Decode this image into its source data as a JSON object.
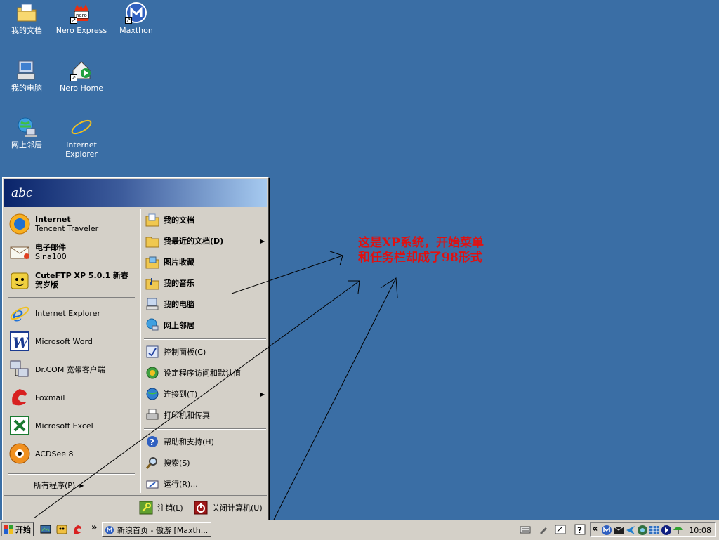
{
  "desktop": {
    "icons": [
      {
        "label": "我的文档",
        "icon": "folder-docs-icon"
      },
      {
        "label": "Nero Express",
        "icon": "nero-express-icon"
      },
      {
        "label": "Maxthon",
        "icon": "maxthon-icon"
      },
      {
        "label": "我的电脑",
        "icon": "computer-icon"
      },
      {
        "label": "Nero Home",
        "icon": "nero-home-icon"
      },
      {
        "label": "网上邻居",
        "icon": "network-icon"
      },
      {
        "label": "Internet Explorer",
        "icon": "ie-icon"
      }
    ]
  },
  "start_menu": {
    "user": "abc",
    "pinned": [
      {
        "title": "Internet",
        "subtitle": "Tencent Traveler"
      },
      {
        "title": "电子邮件",
        "subtitle": "Sina100"
      },
      {
        "title": "CuteFTP XP 5.0.1 新春贺岁版",
        "subtitle": ""
      }
    ],
    "recent": [
      "Internet Explorer",
      "Microsoft Word",
      "Dr.COM 宽带客户端",
      "Foxmail",
      "Microsoft Excel",
      "ACDSee 8"
    ],
    "all_programs": "所有程序(P)",
    "right": [
      {
        "label": "我的文档",
        "bold": true
      },
      {
        "label": "我最近的文档(D)",
        "bold": true,
        "arrow": true
      },
      {
        "label": "图片收藏",
        "bold": true
      },
      {
        "label": "我的音乐",
        "bold": true
      },
      {
        "label": "我的电脑",
        "bold": true
      },
      {
        "label": "网上邻居",
        "bold": true
      },
      {
        "label": "控制面板(C)"
      },
      {
        "label": "设定程序访问和默认值"
      },
      {
        "label": "连接到(T)",
        "arrow": true
      },
      {
        "label": "打印机和传真"
      },
      {
        "label": "帮助和支持(H)"
      },
      {
        "label": "搜索(S)"
      },
      {
        "label": "运行(R)..."
      }
    ],
    "logoff": "注销(L)",
    "shutdown": "关闭计算机(U)"
  },
  "taskbar": {
    "start": "开始",
    "task": "新浪首页 - 傲游 [Maxth...",
    "chevron": "»",
    "tray_chevron": "«",
    "clock": "10:08"
  },
  "annotation": {
    "line1": "这是XP系统，开始菜单",
    "line2": "和任务栏却成了98形式"
  },
  "colors": {
    "desktop": "#3a6ea5",
    "annotation": "#e11010",
    "header": "#0a246a"
  }
}
